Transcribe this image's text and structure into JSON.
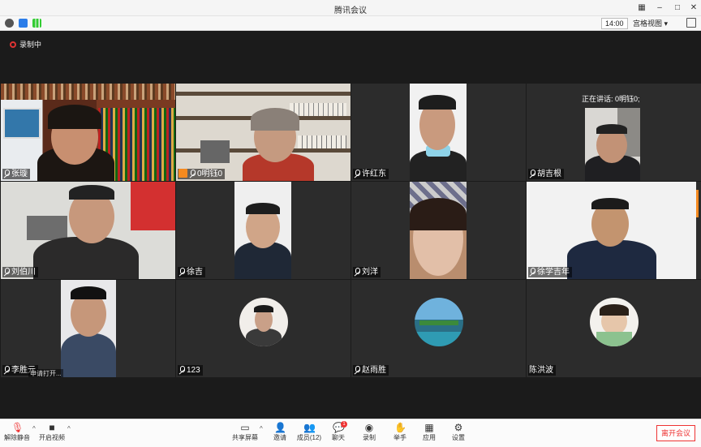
{
  "window": {
    "title": "腾讯会议"
  },
  "status": {
    "time": "14:00",
    "view_mode": "宫格视图 ▾"
  },
  "recording": {
    "label": "录制中"
  },
  "speaking_tip": "正在讲话: 0明钰0;",
  "participants": [
    {
      "name": "张璇"
    },
    {
      "name": "0明钰0",
      "host": true
    },
    {
      "name": "许红东"
    },
    {
      "name": "胡吉根"
    },
    {
      "name": "刘伯川"
    },
    {
      "name": "徐吉"
    },
    {
      "name": "刘洋"
    },
    {
      "name": "徐学吉年"
    },
    {
      "name": "李胜元",
      "extra": "申请打开..."
    },
    {
      "name": "123"
    },
    {
      "name": "赵雨胜"
    },
    {
      "name": "陈洪波"
    }
  ],
  "toolbar": {
    "mute": "解除静音",
    "video": "开启视频",
    "share": "共享屏幕",
    "invite": "邀请",
    "members": "成员(12)",
    "chat": "聊天",
    "record": "录制",
    "raise_hand": "举手",
    "apps": "应用",
    "settings": "设置",
    "leave": "离开会议",
    "chat_badge": "1"
  }
}
